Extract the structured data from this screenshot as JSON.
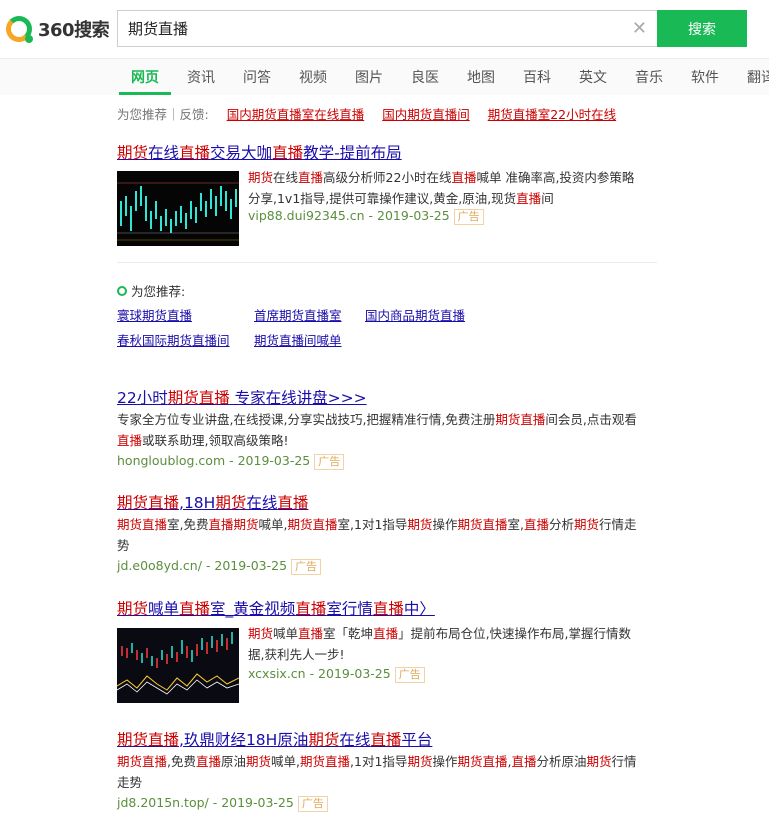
{
  "header": {
    "logo_text": "360搜索",
    "search_value": "期货直播",
    "search_button": "搜索"
  },
  "tabs": [
    "网页",
    "资讯",
    "问答",
    "视频",
    "图片",
    "良医",
    "地图",
    "百科",
    "英文",
    "音乐",
    "软件",
    "翻译"
  ],
  "suggest": {
    "label": "为您推荐｜反馈:",
    "links": [
      "国内期货直播室在线直播",
      "国内期货直播间",
      "期货直播室22小时在线"
    ]
  },
  "result1": {
    "title_parts": [
      "期货",
      "在线",
      "直播",
      "交易大咖",
      "直播",
      "教学-提前布局"
    ],
    "desc_line1_parts": [
      "期货",
      "在线",
      "直播",
      "高级分析师22小时在线",
      "直播",
      "喊单 准确率高,投资内参策略"
    ],
    "desc_line2": "分享,1v1指导,提供可靠操作建议,黄金,原油,现货",
    "desc_line2_em": "直播",
    "desc_line2_end": "间",
    "url": "vip88.dui92345.cn - 2019-03-25",
    "ad": "广告"
  },
  "recommend": {
    "header": "为您推荐:",
    "links": [
      "寰球期货直播",
      "首席期货直播室",
      "国内商品期货直播",
      "春秋国际期货直播间",
      "期货直播间喊单"
    ]
  },
  "result2": {
    "title_parts": [
      "22小时",
      "期货直播",
      " 专家在线讲盘>>>"
    ],
    "desc_line1_a": "专家全方位专业讲盘,在线授课,分享实战技巧,把握精准行情,免费注册",
    "desc_line1_em": "期货直播",
    "desc_line1_b": "间会员,点击观看",
    "desc_line2_em": "直播",
    "desc_line2_b": "或联系助理,领取高级策略!",
    "url": "hongloublog.com - 2019-03-25",
    "ad": "广告"
  },
  "result3": {
    "title_parts": [
      "期货直播",
      ",18H",
      "期货",
      "在线",
      "直播"
    ],
    "desc_line1": [
      [
        "期货直播",
        true
      ],
      [
        "室,免费",
        false
      ],
      [
        "直播",
        true
      ],
      [
        "期货",
        true
      ],
      [
        "喊单,",
        false
      ],
      [
        "期货直播",
        true
      ],
      [
        "室,1对1指导",
        false
      ],
      [
        "期货",
        true
      ],
      [
        "操作",
        false
      ],
      [
        "期货直播",
        true
      ],
      [
        "室,",
        false
      ],
      [
        "直播",
        true
      ],
      [
        "分析",
        false
      ],
      [
        "期货",
        true
      ],
      [
        "行情走",
        false
      ]
    ],
    "desc_line2": "势",
    "url": "jd.e0o8yd.cn/ - 2019-03-25",
    "ad": "广告"
  },
  "result4": {
    "title_parts": [
      "期货",
      "喊单",
      "直播",
      "室_黄金视频",
      "直播",
      "室行情",
      "直播",
      "中〉"
    ],
    "desc_line1": [
      [
        "期货",
        true
      ],
      [
        "喊单",
        false
      ],
      [
        "直播",
        true
      ],
      [
        "室「乾坤",
        false
      ],
      [
        "直播",
        true
      ],
      [
        "」提前布局仓位,快速操作布局,掌握行情数",
        false
      ]
    ],
    "desc_line2": "据,获利先人一步!",
    "url": "xcxsix.cn - 2019-03-25",
    "ad": "广告"
  },
  "result5": {
    "title_parts": [
      "期货直播",
      ",玖鼎财经18H原油",
      "期货",
      "在线",
      "直播",
      "平台"
    ],
    "desc_line1": [
      [
        "期货直播",
        true
      ],
      [
        ",免费",
        false
      ],
      [
        "直播",
        true
      ],
      [
        "原油",
        false
      ],
      [
        "期货",
        true
      ],
      [
        "喊单,",
        false
      ],
      [
        "期货直播",
        true
      ],
      [
        ",1对1指导",
        false
      ],
      [
        "期货",
        true
      ],
      [
        "操作",
        false
      ],
      [
        "期货直播",
        true
      ],
      [
        ",",
        false
      ],
      [
        "直播",
        true
      ],
      [
        "分析原油",
        false
      ],
      [
        "期货",
        true
      ],
      [
        "行情",
        false
      ]
    ],
    "desc_line2": "走势",
    "url": "jd8.2015n.top/ - 2019-03-25",
    "ad": "广告"
  },
  "colors": {
    "accent": "#19b955",
    "link": "#1a0dab",
    "highlight": "#cc0000",
    "url": "#5a8f3c"
  }
}
